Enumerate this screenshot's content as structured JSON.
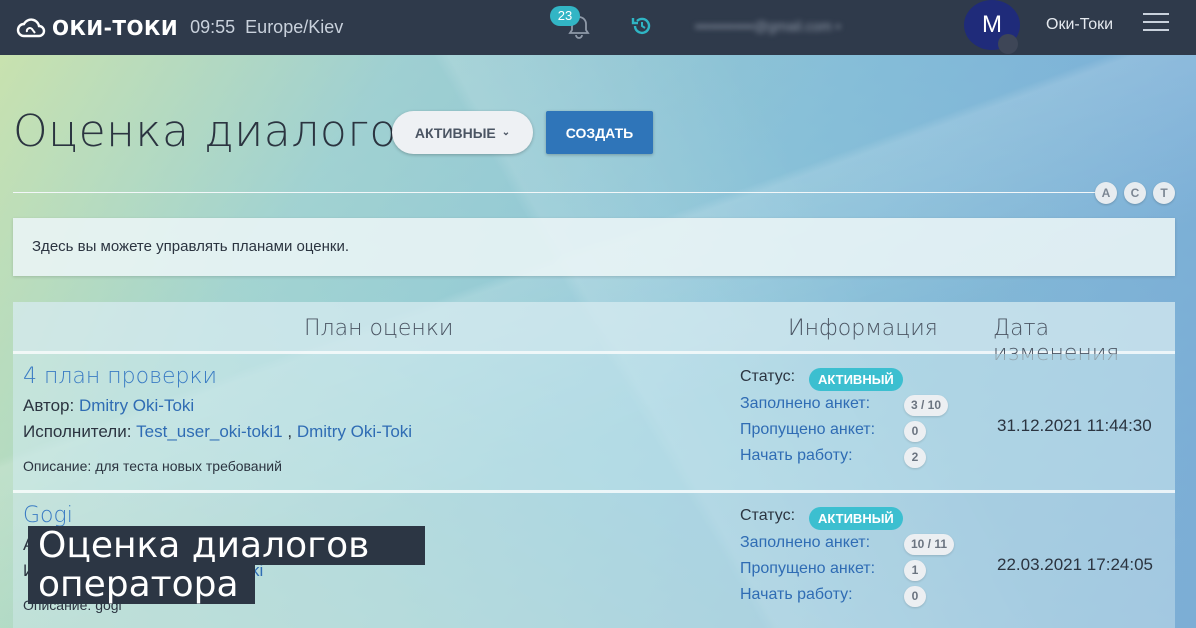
{
  "header": {
    "logo_text": "ОКИ-ТОКИ",
    "time": "09:55",
    "timezone": "Europe/Kiev",
    "notifications_count": "23",
    "email": "••••••••••••@gmail.com •",
    "avatar_letter": "M",
    "user_name": "Оки-Токи"
  },
  "page": {
    "title": "Оценка диалогов",
    "filter_label": "АКТИВНЫЕ",
    "create_label": "СОЗДАТЬ",
    "font_buttons": [
      "A",
      "C",
      "T"
    ],
    "info_text": "Здесь вы можете управлять планами оценки."
  },
  "table": {
    "columns": [
      "План оценки",
      "Информация",
      "Дата изменения"
    ],
    "rows": [
      {
        "name": "4 план проверки",
        "author_label": "Автор:",
        "author": "Dmitry Oki-Toki",
        "executors_label": "Исполнители:",
        "executor_1": "Test_user_oki-toki1",
        "executor_sep": ",",
        "executor_2": "Dmitry Oki-Toki",
        "description": "Описание: для теста новых требований",
        "status_label": "Статус:",
        "status": "АКТИВНЫЙ",
        "filled_label": "Заполнено анкет:",
        "filled": "3 / 10",
        "skipped_label": "Пропущено анкет:",
        "skipped": "0",
        "start_label": "Начать работу:",
        "start": "2",
        "date": "31.12.2021 11:44:30"
      },
      {
        "name": "Gogi",
        "author_label": "А",
        "executors_label": "И",
        "executor_2": "Toki",
        "description": "Описание: gogi",
        "status_label": "Статус:",
        "status": "АКТИВНЫЙ",
        "filled_label": "Заполнено анкет:",
        "filled": "10 / 11",
        "skipped_label": "Пропущено анкет:",
        "skipped": "1",
        "start_label": "Начать работу:",
        "start": "0",
        "date": "22.03.2021 17:24:05"
      }
    ]
  },
  "caption": {
    "line1": "Оценка диалогов",
    "line2": "оператора"
  },
  "colors": {
    "topbar": "#2f3a4b",
    "accent": "#2f75b9",
    "status_active": "#3cbfd0",
    "link": "#2f6cb4"
  }
}
